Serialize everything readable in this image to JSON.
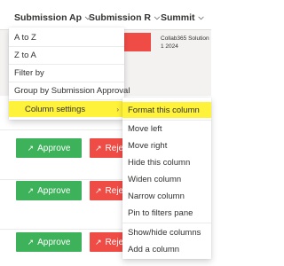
{
  "columns": [
    {
      "label": "Submission Ap..."
    },
    {
      "label": "Submission Rej..."
    },
    {
      "label": "Summit"
    }
  ],
  "summit_cell": {
    "line1": "Collab365 Solution",
    "line2": "1 2024"
  },
  "rows": [
    {
      "approve_label": "Approve",
      "reject_label": "Reject"
    },
    {
      "approve_label": "Approve",
      "reject_label": "Reject"
    },
    {
      "approve_label": "Approve",
      "reject_label": "Reject"
    }
  ],
  "menu": {
    "items": [
      {
        "label": "A to Z"
      },
      {
        "label": "Z to A"
      },
      {
        "label": "Filter by"
      },
      {
        "label": "Group by Submission Approval"
      },
      {
        "label": "Column settings"
      }
    ]
  },
  "submenu": {
    "items": [
      {
        "label": "Format this column"
      },
      {
        "label": "Move left"
      },
      {
        "label": "Move right"
      },
      {
        "label": "Hide this column"
      },
      {
        "label": "Widen column"
      },
      {
        "label": "Narrow column"
      },
      {
        "label": "Pin to filters pane"
      },
      {
        "label": "Show/hide columns"
      },
      {
        "label": "Add a column"
      }
    ]
  },
  "colors": {
    "approve": "#3db25a",
    "reject": "#f04c46",
    "highlight": "#fff23a"
  },
  "icons": {
    "approve": "link-icon",
    "reject": "link-icon",
    "column_menu": "chevron-down-icon",
    "submenu_arrow": "chevron-right-icon"
  }
}
